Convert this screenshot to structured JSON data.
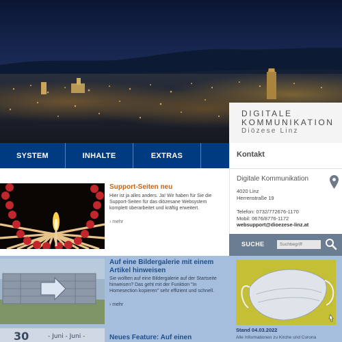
{
  "brand": {
    "line1": "DIGITALE",
    "line2": "KOMMUNIKATION",
    "line3": "Diözese Linz"
  },
  "nav": {
    "items": [
      "SYSTEM",
      "INHALTE",
      "EXTRAS",
      ""
    ]
  },
  "contact": {
    "heading": "Kontakt",
    "org": "Digitale Kommunikation",
    "address_line1": "4020 Linz",
    "address_line2": "Herrenstraße 19",
    "phone": "Telefon: 0732/772676-1170",
    "mobile": "Mobil: 0676/8776-1172",
    "email": "websupport@dioezese-linz.at"
  },
  "search": {
    "label": "SUCHE",
    "placeholder": "Suchbegriff"
  },
  "articles": [
    {
      "title": "Support-Seiten neu",
      "body": "Hier ist ja alles anders. Ja! Wir haben für Sie die Support-Seiten für das diözesane Websystem komplett überarbeitet und kräftig erweitert.",
      "more": "mehr"
    },
    {
      "title": "Auf eine Bildergalerie mit einem Artikel hinweisen",
      "body": "Sie wollten auf eine Bildergalerie auf der Startseite hinweisen? Das geht mit der Funktion \"In Homesection kopieren\" sehr effizient und schnell.",
      "more": "mehr"
    },
    {
      "title": "Neues Feature: Auf einen",
      "body": "",
      "more": ""
    }
  ],
  "sidebar_news": {
    "date": "Stand 04.03.2022",
    "text": "Alle Informationen zu Kirche und Corona"
  },
  "colors": {
    "nav_bg": "#003a80",
    "title_orange": "#2f6fb3",
    "search_bg": "#6b7d93"
  }
}
